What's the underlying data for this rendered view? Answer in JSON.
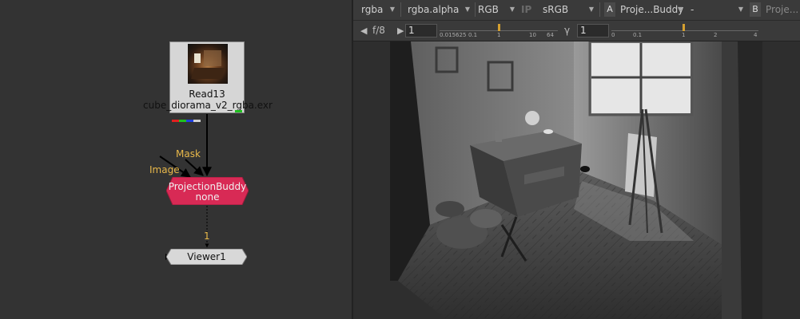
{
  "node_graph": {
    "read_node": {
      "title": "Read13",
      "filename": "cube_diorama_v2_rgba.exr"
    },
    "projection_node": {
      "title": "ProjectionBuddy",
      "subtitle": "none",
      "color": "#d82a55"
    },
    "viewer_node": {
      "label": "Viewer1"
    },
    "edge_labels": {
      "mask": "Mask",
      "image": "Image",
      "viewer_input": "1"
    }
  },
  "viewer": {
    "toolbar1": {
      "layer": "rgba",
      "channel": "rgba.alpha",
      "display": "RGB",
      "ip": "IP",
      "colorspace": "sRGB",
      "a_label": "A",
      "a_input": "Proje...Buddy",
      "a_op": "-",
      "b_label": "B",
      "b_input": "Proje..."
    },
    "toolbar2": {
      "fstop_label": "f/8",
      "gain_value": "1",
      "gain_ticks": [
        "0.015625",
        "0.1",
        "1",
        "10",
        "64"
      ],
      "gamma_label": "γ",
      "gamma_value": "1",
      "gamma_ticks": [
        "0",
        "0.1",
        "1",
        "2",
        "4"
      ],
      "gain_level": 1,
      "gamma_level": 1
    }
  },
  "colors": {
    "accent": "#e8b84a",
    "node_pink": "#d82a55"
  },
  "icons": [
    "triangle-left-icon",
    "triangle-right-icon",
    "dropdown-arrow-icon"
  ]
}
